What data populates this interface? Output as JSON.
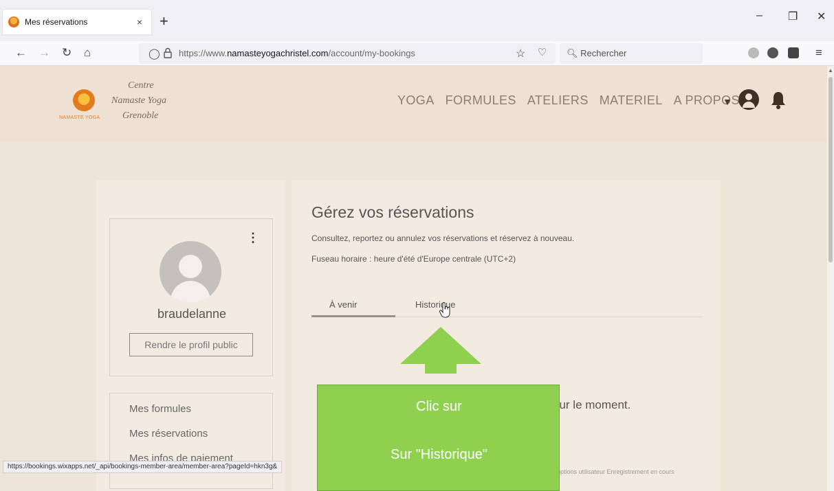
{
  "browser": {
    "tab_title": "Mes réservations",
    "tab_close": "×",
    "new_tab": "+",
    "url_prefix": "https://www.",
    "url_domain": "namasteyogachristel.com",
    "url_path": "/account/my-bookings",
    "search_placeholder": "Rechercher",
    "window_controls": [
      "–",
      "❐",
      "✕"
    ]
  },
  "header": {
    "brand_lines": [
      "Centre",
      "Namaste Yoga",
      "Grenoble"
    ],
    "logo_caption": "NAMASTE YOGA",
    "nav": [
      "YOGA",
      "FORMULES",
      "ATELIERS",
      "MATERIEL",
      "A PROPOS..."
    ]
  },
  "profile": {
    "username": "braudelanne",
    "public_button": "Rendre le profil public",
    "kebab": "⋮",
    "menu": [
      "Mes formules",
      "Mes réservations",
      "Mes infos de paiement"
    ]
  },
  "bookings": {
    "title": "Gérez vos réservations",
    "subtitle": "Consultez, reportez ou annulez vos réservations et réservez à nouveau.",
    "timezone": "Fuseau horaire : heure d'été d'Europe centrale (UTC+2)",
    "tabs": [
      "À venir",
      "Historique"
    ],
    "active_tab": "À venir",
    "empty_message": "our le moment."
  },
  "status": {
    "link": "https://bookings.wixapps.net/_api/bookings-member-area/member-area?pageId=hkn3g&",
    "right_text": "options utilisateur  Enregistrement en cours"
  },
  "callout": {
    "line1": "Clic sur",
    "line2": "Sur \"Historique\"",
    "color": "#8fd14f"
  }
}
